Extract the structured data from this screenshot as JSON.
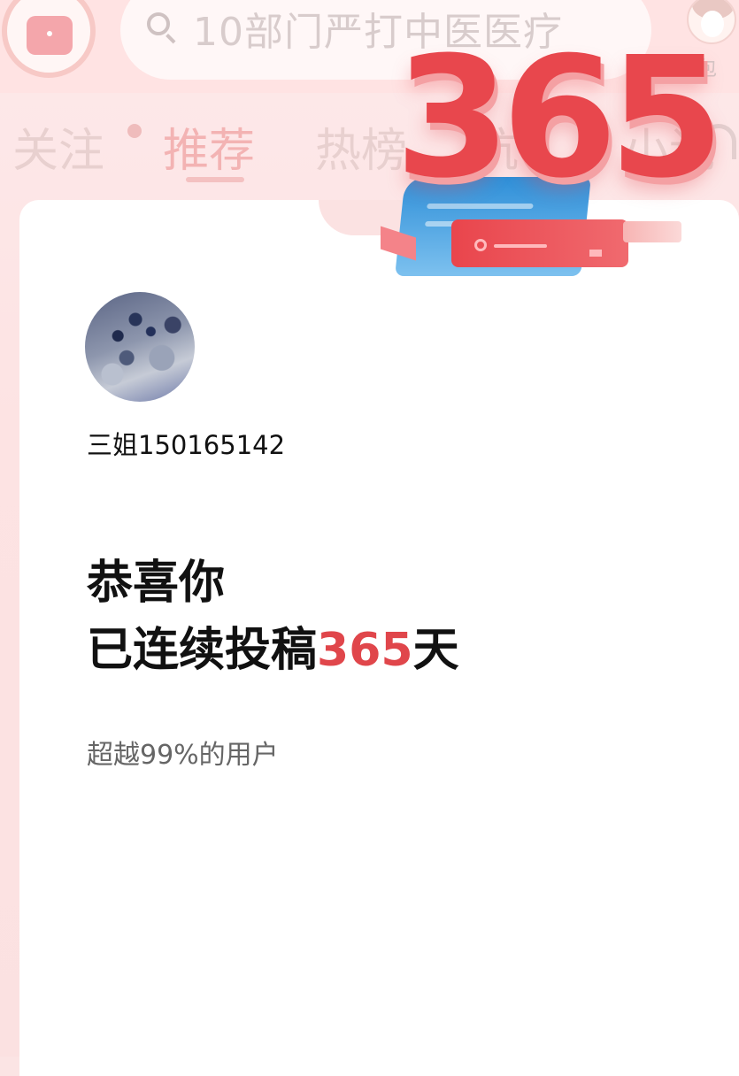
{
  "header": {
    "search": {
      "query_text": "10部门严打中医医疗"
    },
    "doubao_label": "豆包",
    "tabs": [
      {
        "label": "关注"
      },
      {
        "label": "推荐",
        "active": true
      },
      {
        "label": "热榜"
      },
      {
        "label": "抗"
      },
      {
        "label": "小说"
      }
    ]
  },
  "badge": {
    "number": "365"
  },
  "card": {
    "username": "三姐150165142",
    "congrats": "恭喜你",
    "streak_prefix": "已连续投稿",
    "streak_days": "365",
    "streak_suffix": "天",
    "surpass_text": "超越99%的用户"
  },
  "colors": {
    "accent": "#e0464b",
    "background": "#fbe4e4"
  }
}
